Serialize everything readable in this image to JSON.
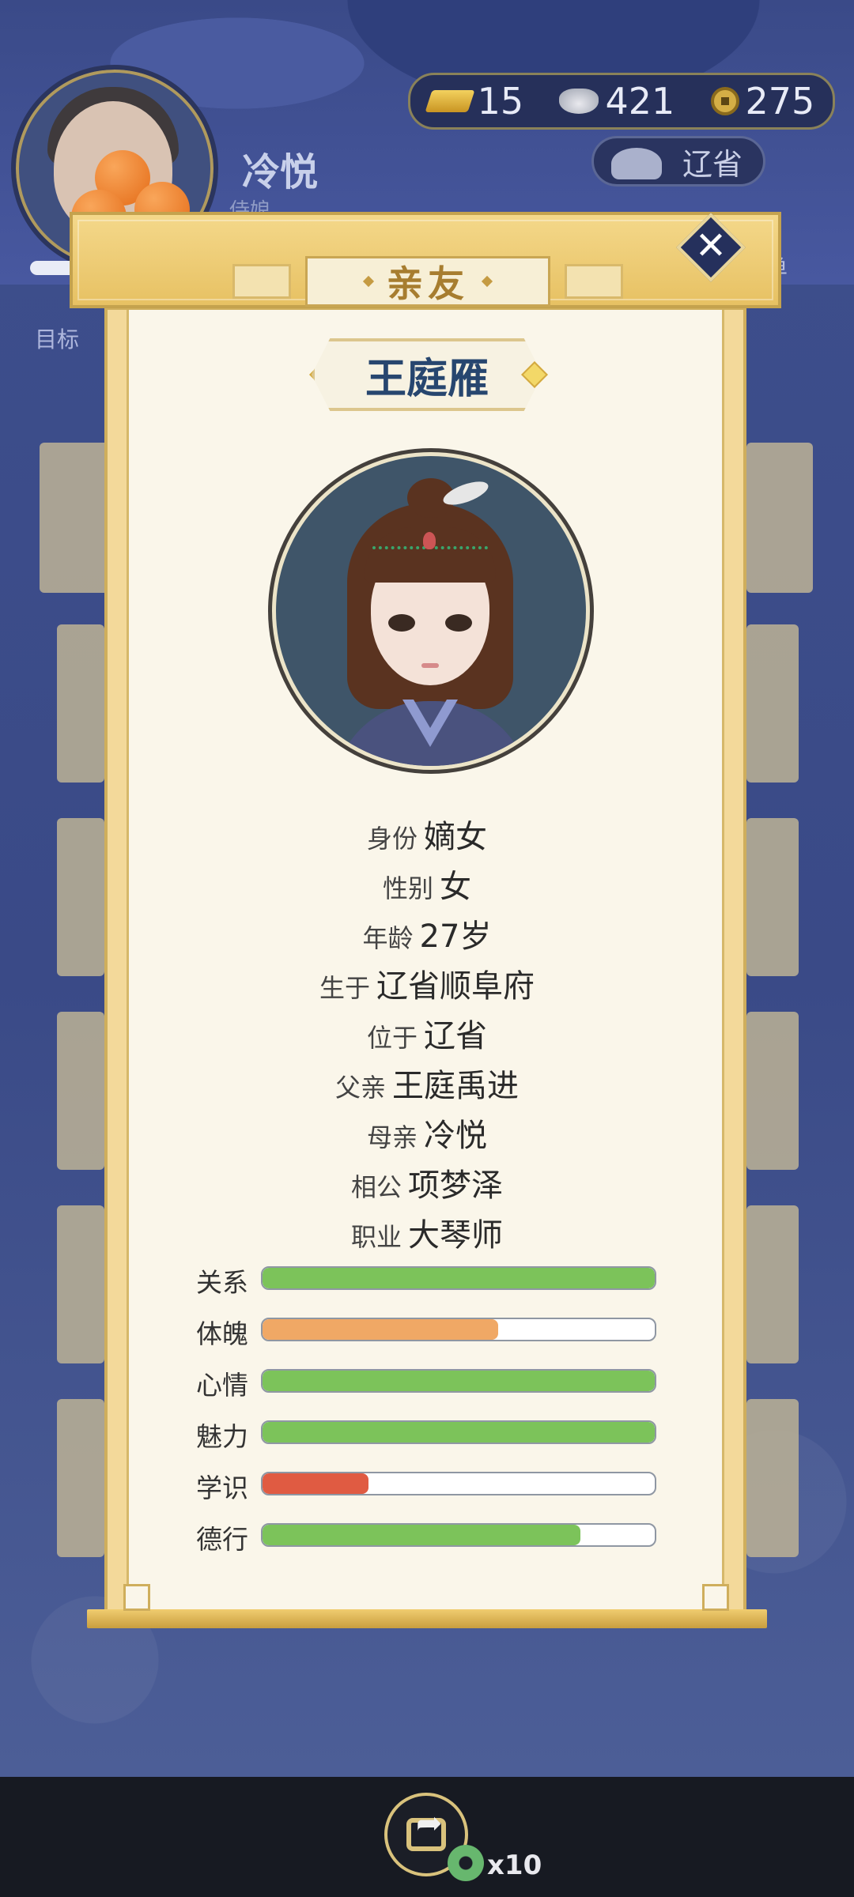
{
  "header": {
    "player_name": "冷悦",
    "player_sub": "侍娘",
    "goal_label": "目标",
    "currency": {
      "gold": "15",
      "silver": "421",
      "coin": "275"
    },
    "location": "辽省",
    "menu_label": "菜单"
  },
  "dialog": {
    "title": "亲友",
    "character_name": "王庭雁",
    "info": [
      {
        "label": "身份",
        "value": "嫡女"
      },
      {
        "label": "性别",
        "value": "女"
      },
      {
        "label": "年龄",
        "value": "27岁"
      },
      {
        "label": "生于",
        "value": "辽省顺阜府"
      },
      {
        "label": "位于",
        "value": "辽省"
      },
      {
        "label": "父亲",
        "value": "王庭禹进"
      },
      {
        "label": "母亲",
        "value": "冷悦"
      },
      {
        "label": "相公",
        "value": "项梦泽"
      },
      {
        "label": "职业",
        "value": "大琴师"
      }
    ],
    "stats": [
      {
        "label": "关系",
        "fraction": 1.0,
        "color": "#7cc35a"
      },
      {
        "label": "体魄",
        "fraction": 0.6,
        "color": "#f0a865"
      },
      {
        "label": "心情",
        "fraction": 1.0,
        "color": "#7cc35a"
      },
      {
        "label": "魅力",
        "fraction": 1.0,
        "color": "#7cc35a"
      },
      {
        "label": "学识",
        "fraction": 0.27,
        "color": "#e05b42"
      },
      {
        "label": "德行",
        "fraction": 0.81,
        "color": "#7cc35a"
      }
    ]
  },
  "bottom": {
    "multiplier": "x10"
  }
}
